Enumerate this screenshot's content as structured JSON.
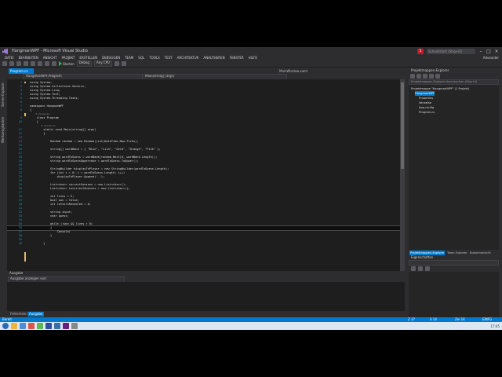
{
  "window": {
    "title": "HangmanWPF - Microsoft Visual Studio",
    "quick_launch": "Schnellstart (Strg+Q)",
    "notification_count": "1"
  },
  "menu": [
    "DATEI",
    "BEARBEITEN",
    "ANSICHT",
    "PROJEKT",
    "ERSTELLEN",
    "DEBUGGEN",
    "TEAM",
    "SQL",
    "TOOLS",
    "TEST",
    "ARCHITEKTUR",
    "ANALYSIEREN",
    "FENSTER",
    "HILFE"
  ],
  "user": "Alexander",
  "toolbar": {
    "start_label": "Starten",
    "config": "Debug",
    "platform": "Any CPU"
  },
  "left_strip": [
    "Server-Explorer",
    "Werkzeugkasten"
  ],
  "editor": {
    "tabs": [
      {
        "label": "Program.cs",
        "active": true
      },
      {
        "label": "MainWindow.xaml",
        "active": false
      }
    ],
    "nav": {
      "left": "HangmanWPF.Program",
      "right": "Main(string[] args)"
    },
    "current_line": "36",
    "lines": [
      {
        "n": "1",
        "t": "using System;"
      },
      {
        "n": "2",
        "t": "using System.Collections.Generic;"
      },
      {
        "n": "3",
        "t": "using System.Linq;"
      },
      {
        "n": "4",
        "t": "using System.Text;"
      },
      {
        "n": "5",
        "t": "using System.Threading.Tasks;"
      },
      {
        "n": "6",
        "t": ""
      },
      {
        "n": "7",
        "t": "namespace HangmanWPF"
      },
      {
        "n": "8",
        "t": "{"
      },
      {
        "n": "",
        "t": "    0 Verweise"
      },
      {
        "n": "9",
        "t": "    class Program"
      },
      {
        "n": "10",
        "t": "    {"
      },
      {
        "n": "",
        "t": "        0 Verweise"
      },
      {
        "n": "11",
        "t": "        static void Main(string[] args)"
      },
      {
        "n": "12",
        "t": "        {"
      },
      {
        "n": "13",
        "t": ""
      },
      {
        "n": "14",
        "t": "            Random random = new Random((int)DateTime.Now.Ticks);"
      },
      {
        "n": "15",
        "t": ""
      },
      {
        "n": "16",
        "t": "            string[] wordBank = { \"Blue\", \"Lila\", \"Gelb\", \"Orange\", \"Pink\" };"
      },
      {
        "n": "17",
        "t": ""
      },
      {
        "n": "18",
        "t": "            string wordToGuess = wordBank[random.Next(0, wordBank.Length)];"
      },
      {
        "n": "19",
        "t": "            string wordToGuessUppercase = wordToGuess.ToUpper();"
      },
      {
        "n": "20",
        "t": ""
      },
      {
        "n": "21",
        "t": "            StringBuilder displayToPlayer = new StringBuilder(wordToGuess.Length);"
      },
      {
        "n": "22",
        "t": "            for (int i = 0; i < wordToGuess.Length; i++)"
      },
      {
        "n": "23",
        "t": "                displayToPlayer.Append('_');"
      },
      {
        "n": "24",
        "t": ""
      },
      {
        "n": "25",
        "t": "            List<char> correctGuesses = new List<char>();"
      },
      {
        "n": "26",
        "t": "            List<char> incorrectGuesses = new List<char>();"
      },
      {
        "n": "27",
        "t": ""
      },
      {
        "n": "28",
        "t": "            int lives = 5;"
      },
      {
        "n": "29",
        "t": "            bool won = false;"
      },
      {
        "n": "30",
        "t": "            int lettersRevealed = 0;"
      },
      {
        "n": "31",
        "t": ""
      },
      {
        "n": "32",
        "t": "            string input;"
      },
      {
        "n": "33",
        "t": "            char guess;"
      },
      {
        "n": "34",
        "t": ""
      },
      {
        "n": "35",
        "t": "            while (!won && lives > 0)"
      },
      {
        "n": "36",
        "t": "            {"
      },
      {
        "n": "37",
        "t": "                Console|"
      },
      {
        "n": "38",
        "t": "            }"
      },
      {
        "n": "39",
        "t": ""
      },
      {
        "n": "40",
        "t": "        }"
      }
    ]
  },
  "output": {
    "title": "Ausgabe",
    "source": "Ausgabe anzeigen von:"
  },
  "bottom_tabs": [
    {
      "label": "Fehlerliste",
      "active": false
    },
    {
      "label": "Ausgabe",
      "active": true
    }
  ],
  "solution_explorer": {
    "title": "Projektmappen-Explorer",
    "search_placeholder": "Projektmappen-Explorer durchsuchen (Strg+ü)",
    "nodes": [
      {
        "label": "Projektmappe \"HangmanWPF\" (1 Projekt)",
        "level": 0,
        "selected": false
      },
      {
        "label": "HangmanWPF",
        "level": 1,
        "selected": true
      },
      {
        "label": "Properties",
        "level": 2,
        "selected": false
      },
      {
        "label": "Verweise",
        "level": 2,
        "selected": false
      },
      {
        "label": "App.config",
        "level": 2,
        "selected": false
      },
      {
        "label": "Program.cs",
        "level": 2,
        "selected": false
      }
    ],
    "tabs": [
      {
        "label": "Projektmappen-Explorer",
        "active": true
      },
      {
        "label": "Team Explorer",
        "active": false
      },
      {
        "label": "Klassenansicht",
        "active": false
      }
    ]
  },
  "properties": {
    "title": "Eigenschaften"
  },
  "status": {
    "left": "Bereit",
    "line": "Z 37",
    "col": "S 14",
    "char": "Zei 14",
    "mode": "EINFG"
  },
  "taskbar": {
    "clock": "17:05"
  },
  "colors": {
    "accent": "#007acc",
    "editor_bg": "#1e1e1e",
    "chrome": "#2d2d30",
    "line_number": "#2b91af"
  }
}
